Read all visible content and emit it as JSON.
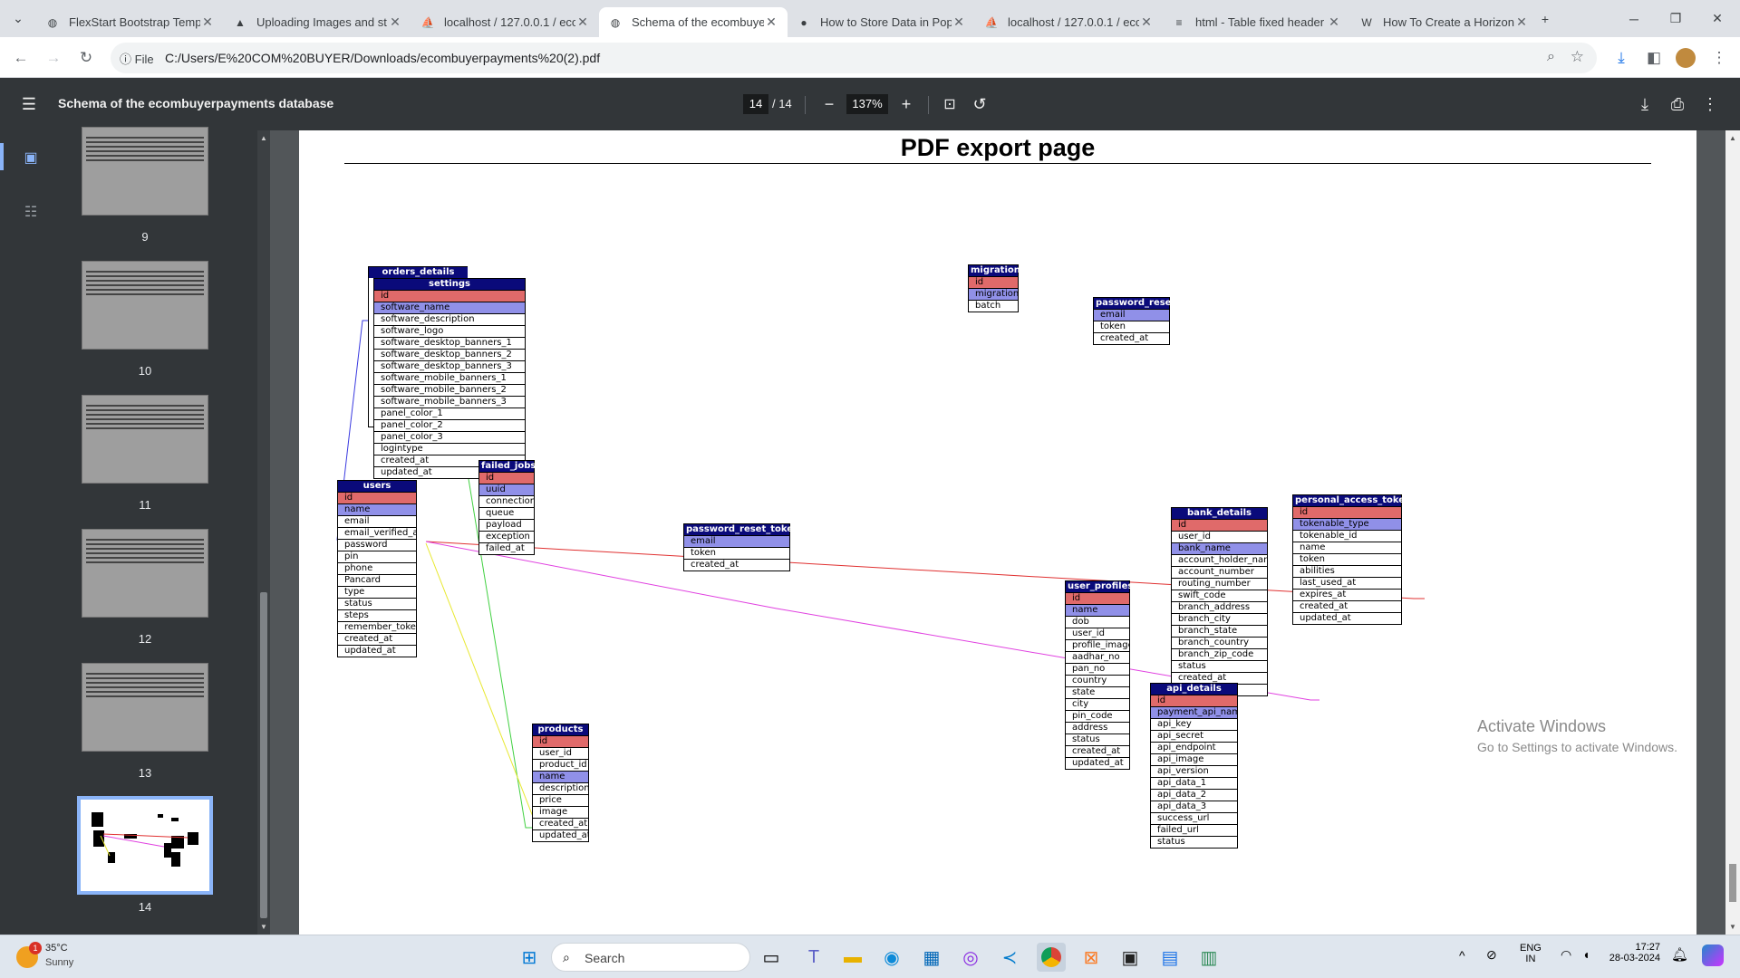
{
  "browser": {
    "tabs": [
      {
        "title": "FlexStart Bootstrap Templ",
        "icon": "globe-icon",
        "active": false
      },
      {
        "title": "Uploading Images and st",
        "icon": "a-logo-icon",
        "active": false
      },
      {
        "title": "localhost / 127.0.0.1 / eco",
        "icon": "phpmyadmin-icon",
        "active": false
      },
      {
        "title": "Schema of the ecombuye",
        "icon": "globe-icon",
        "active": true
      },
      {
        "title": "How to Store Data in Pop",
        "icon": "medium-icon",
        "active": false
      },
      {
        "title": "localhost / 127.0.0.1 / eco",
        "icon": "phpmyadmin-icon",
        "active": false
      },
      {
        "title": "html - Table fixed header",
        "icon": "stackoverflow-icon",
        "active": false
      },
      {
        "title": "How To Create a Horizont",
        "icon": "w3schools-icon",
        "active": false
      }
    ],
    "new_tab": "+",
    "info_label": "File",
    "url": "C:/Users/E%20COM%20BUYER/Downloads/ecombuyerpayments%20(2).pdf"
  },
  "pdf": {
    "title": "Schema of the ecombuyerpayments database",
    "current_page": "14",
    "total_pages": "/ 14",
    "zoom": "137%",
    "thumbs": [
      {
        "num": "9"
      },
      {
        "num": "10"
      },
      {
        "num": "11"
      },
      {
        "num": "12"
      },
      {
        "num": "13"
      },
      {
        "num": "14"
      }
    ],
    "page_heading": "PDF export page"
  },
  "tables": {
    "orders_details": {
      "title": "orders_details"
    },
    "settings": {
      "title": "settings",
      "fields": [
        {
          "n": "id",
          "k": "pk"
        },
        {
          "n": "software_name",
          "k": "ix"
        },
        {
          "n": "software_description"
        },
        {
          "n": "software_logo"
        },
        {
          "n": "software_desktop_banners_1"
        },
        {
          "n": "software_desktop_banners_2"
        },
        {
          "n": "software_desktop_banners_3"
        },
        {
          "n": "software_mobile_banners_1"
        },
        {
          "n": "software_mobile_banners_2"
        },
        {
          "n": "software_mobile_banners_3"
        },
        {
          "n": "panel_color_1"
        },
        {
          "n": "panel_color_2"
        },
        {
          "n": "panel_color_3"
        },
        {
          "n": "logintype"
        },
        {
          "n": "created_at"
        },
        {
          "n": "updated_at"
        }
      ]
    },
    "migrations": {
      "title": "migrations",
      "fields": [
        {
          "n": "id",
          "k": "pk"
        },
        {
          "n": "migration",
          "k": "ix"
        },
        {
          "n": "batch"
        }
      ]
    },
    "password_resets": {
      "title": "password_resets",
      "fields": [
        {
          "n": "email",
          "k": "ix"
        },
        {
          "n": "token"
        },
        {
          "n": "created_at"
        }
      ]
    },
    "failed_jobs": {
      "title": "failed_jobs",
      "fields": [
        {
          "n": "id",
          "k": "pk"
        },
        {
          "n": "uuid",
          "k": "ix"
        },
        {
          "n": "connection"
        },
        {
          "n": "queue"
        },
        {
          "n": "payload"
        },
        {
          "n": "exception"
        },
        {
          "n": "failed_at"
        }
      ]
    },
    "users": {
      "title": "users",
      "fields": [
        {
          "n": "id",
          "k": "pk"
        },
        {
          "n": "name",
          "k": "ix"
        },
        {
          "n": "email"
        },
        {
          "n": "email_verified_at"
        },
        {
          "n": "password"
        },
        {
          "n": "pin"
        },
        {
          "n": "phone"
        },
        {
          "n": "Pancard"
        },
        {
          "n": "type"
        },
        {
          "n": "status"
        },
        {
          "n": "steps"
        },
        {
          "n": "remember_token"
        },
        {
          "n": "created_at"
        },
        {
          "n": "updated_at"
        }
      ]
    },
    "password_reset_tokens": {
      "title": "password_reset_tokens",
      "fields": [
        {
          "n": "email",
          "k": "ix"
        },
        {
          "n": "token"
        },
        {
          "n": "created_at"
        }
      ]
    },
    "bank_details": {
      "title": "bank_details",
      "fields": [
        {
          "n": "id",
          "k": "pk"
        },
        {
          "n": "user_id"
        },
        {
          "n": "bank_name",
          "k": "ix"
        },
        {
          "n": "account_holder_name"
        },
        {
          "n": "account_number"
        },
        {
          "n": "routing_number"
        },
        {
          "n": "swift_code"
        },
        {
          "n": "branch_address"
        },
        {
          "n": "branch_city"
        },
        {
          "n": "branch_state"
        },
        {
          "n": "branch_country"
        },
        {
          "n": "branch_zip_code"
        },
        {
          "n": "status"
        },
        {
          "n": "created_at"
        },
        {
          "n": "updated_at"
        }
      ]
    },
    "personal_access_tokens": {
      "title": "personal_access_tokens",
      "fields": [
        {
          "n": "id",
          "k": "pk"
        },
        {
          "n": "tokenable_type",
          "k": "ix"
        },
        {
          "n": "tokenable_id"
        },
        {
          "n": "name"
        },
        {
          "n": "token"
        },
        {
          "n": "abilities"
        },
        {
          "n": "last_used_at"
        },
        {
          "n": "expires_at"
        },
        {
          "n": "created_at"
        },
        {
          "n": "updated_at"
        }
      ]
    },
    "user_profiles": {
      "title": "user_profiles",
      "fields": [
        {
          "n": "id",
          "k": "pk"
        },
        {
          "n": "name",
          "k": "ix"
        },
        {
          "n": "dob"
        },
        {
          "n": "user_id"
        },
        {
          "n": "profile_image"
        },
        {
          "n": "aadhar_no"
        },
        {
          "n": "pan_no"
        },
        {
          "n": "country"
        },
        {
          "n": "state"
        },
        {
          "n": "city"
        },
        {
          "n": "pin_code"
        },
        {
          "n": "address"
        },
        {
          "n": "status"
        },
        {
          "n": "created_at"
        },
        {
          "n": "updated_at"
        }
      ]
    },
    "api_details": {
      "title": "api_details",
      "fields": [
        {
          "n": "id",
          "k": "pk"
        },
        {
          "n": "payment_api_name",
          "k": "ix"
        },
        {
          "n": "api_key"
        },
        {
          "n": "api_secret"
        },
        {
          "n": "api_endpoint"
        },
        {
          "n": "api_image"
        },
        {
          "n": "api_version"
        },
        {
          "n": "api_data_1"
        },
        {
          "n": "api_data_2"
        },
        {
          "n": "api_data_3"
        },
        {
          "n": "success_url"
        },
        {
          "n": "failed_url"
        },
        {
          "n": "status"
        }
      ]
    },
    "products": {
      "title": "products",
      "fields": [
        {
          "n": "id",
          "k": "pk"
        },
        {
          "n": "user_id"
        },
        {
          "n": "product_id"
        },
        {
          "n": "name",
          "k": "ix"
        },
        {
          "n": "description"
        },
        {
          "n": "price"
        },
        {
          "n": "image"
        },
        {
          "n": "created_at"
        },
        {
          "n": "updated_at"
        }
      ]
    }
  },
  "relation_colors": {
    "blue": "#3a3ae0",
    "red": "#e03030",
    "magenta": "#e040e0",
    "yellow": "#e8e830",
    "green": "#40d040"
  },
  "watermark": {
    "line1": "Activate Windows",
    "line2": "Go to Settings to activate Windows."
  },
  "taskbar": {
    "weather_temp": "35°C",
    "weather_desc": "Sunny",
    "weather_badge": "1",
    "search_placeholder": "Search",
    "lang1": "ENG",
    "lang2": "IN",
    "time": "17:27",
    "date": "28-03-2024"
  }
}
